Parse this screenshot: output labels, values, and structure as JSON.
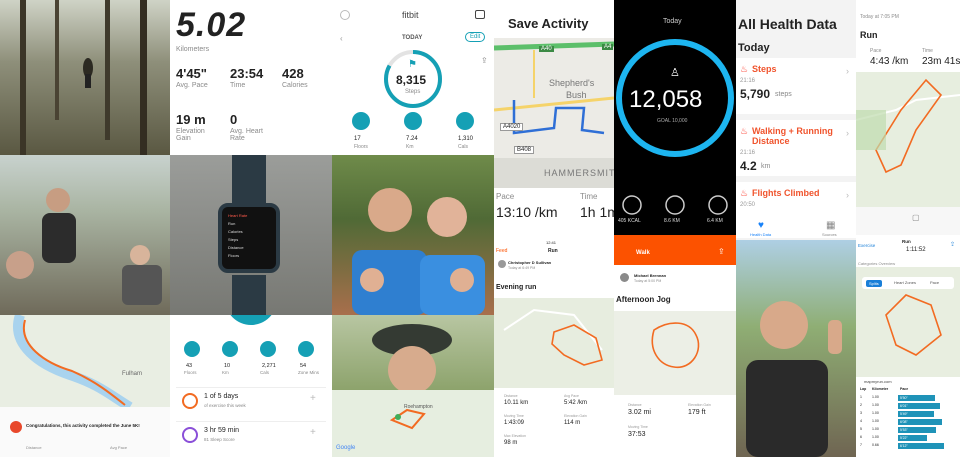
{
  "run_stats": {
    "distance": "5.02",
    "distance_unit": "Kilometers",
    "pace": "4'45\"",
    "pace_label": "Avg. Pace",
    "time": "23:54",
    "time_label": "Time",
    "calories": "428",
    "calories_label": "Calories",
    "elevation": "19 m",
    "elevation_label": "Elevation Gain",
    "heart": "0",
    "heart_label": "Avg. Heart Rate"
  },
  "fitbit": {
    "title": "fitbit",
    "today": "TODAY",
    "edit": "Edit",
    "steps": "8,315",
    "steps_label": "Steps",
    "stats": [
      {
        "value": "17",
        "label": "Floors",
        "icon": "stairs-icon"
      },
      {
        "value": "7.24",
        "label": "Km",
        "icon": "location-pin-icon"
      },
      {
        "value": "1,310",
        "label": "Cals",
        "icon": "flame-icon"
      }
    ]
  },
  "save_activity": {
    "title": "Save Activity",
    "map_labels": [
      "A40",
      "Shepherd's",
      "Bush",
      "A4020",
      "B408",
      "HAMMERSMITH",
      "A4"
    ],
    "pace_label": "Pace",
    "pace": "13:10 /km",
    "time_label": "Time",
    "time": "1h 1m"
  },
  "watch": {
    "today": "Today",
    "steps": "12,058",
    "goal": "GOAL 10,000",
    "metrics": [
      "405 KCAL",
      "8.6 KM",
      "6.4 KM"
    ]
  },
  "health": {
    "title": "All Health Data",
    "today": "Today",
    "items": [
      {
        "name": "Steps",
        "time": "21:16",
        "value": "5,790",
        "unit": "steps"
      },
      {
        "name": "Walking + Running Distance",
        "time": "21:16",
        "value": "4.2",
        "unit": "km"
      },
      {
        "name": "Flights Climbed",
        "time": "20:50",
        "value": "",
        "unit": ""
      }
    ],
    "tabs": [
      "Health Data",
      "Sources"
    ]
  },
  "strava_right": {
    "top_label": "Today at 7:05 PM",
    "title": "Run",
    "pace_label": "Pace",
    "pace": "4:43 /km",
    "time_label": "Time",
    "time": "23m 41s"
  },
  "watch_photo": {
    "screen_lines": [
      "Heart Rate",
      "Run",
      "Calories",
      "Steps",
      "Distance",
      "Floors"
    ]
  },
  "fitbit_bottom": {
    "stats": [
      {
        "value": "43",
        "label": "Floors"
      },
      {
        "value": "10",
        "label": "Km"
      },
      {
        "value": "2,271",
        "label": "Cals"
      },
      {
        "value": "54",
        "label": "Zone Mins"
      }
    ],
    "rows": [
      {
        "title": "1 of 5 days",
        "sub": "of exercise this week"
      },
      {
        "title": "3 hr 59 min",
        "sub": "81 Sleep Score"
      }
    ]
  },
  "evening_run": {
    "status": "12:41",
    "back": "Feed",
    "tab": "Run",
    "user": "Christopher D Sullivan",
    "user_sub": "Today at 6:49 PM",
    "title": "Evening run",
    "stats": [
      {
        "label": "Distance",
        "value": "10.11 km"
      },
      {
        "label": "Avg Pace",
        "value": "5:42 /km"
      },
      {
        "label": "Moving Time",
        "value": "1:43:09"
      },
      {
        "label": "Elevation Gain",
        "value": "114 m"
      },
      {
        "label": "Max Elevation",
        "value": "98 m"
      }
    ]
  },
  "afternoon_jog": {
    "header": "Walk",
    "user": "Michael Brennan",
    "user_sub": "Today at 5:00 PM",
    "title": "Afternoon Jog",
    "stats": [
      {
        "label": "Distance",
        "value": "3.02 mi"
      },
      {
        "label": "Elevation Gain",
        "value": "179 ft"
      },
      {
        "label": "Moving Time",
        "value": "37:53"
      }
    ]
  },
  "congrats": {
    "text": "Congratulations, this activity completed the June 5K!",
    "labels": [
      "Distance",
      "Avg Pace"
    ]
  },
  "map_labels": {
    "fulham": "Fulham",
    "google": "Google",
    "roehampton": "Roehampton"
  },
  "splits": {
    "back": "Exercise",
    "title": "Run",
    "time": "1:11:52",
    "tab_label": "Categories Overview",
    "tabs": [
      "Splits",
      "Heart Zones",
      "Pace"
    ],
    "url": "mapmyrun.com",
    "headers": [
      "Lap",
      "Kilometer",
      "Pace"
    ],
    "rows": [
      {
        "lap": "1",
        "km": "1.00",
        "pace": "5'50\"",
        "fill": 0.72
      },
      {
        "lap": "2",
        "km": "1.00",
        "pace": "6'01\"",
        "fill": 0.8
      },
      {
        "lap": "3",
        "km": "1.00",
        "pace": "5'49\"",
        "fill": 0.7
      },
      {
        "lap": "4",
        "km": "1.00",
        "pace": "6'08\"",
        "fill": 0.85
      },
      {
        "lap": "5",
        "km": "1.00",
        "pace": "5'53\"",
        "fill": 0.74
      },
      {
        "lap": "6",
        "km": "1.00",
        "pace": "5'22\"",
        "fill": 0.55
      },
      {
        "lap": "7",
        "km": "0.66",
        "pace": "6'12\"",
        "fill": 0.88
      }
    ]
  },
  "colors": {
    "fitbit_teal": "#15a0b5",
    "strava_orange": "#fc5200",
    "health_red": "#fb3c2d",
    "watch_blue": "#1db5f0"
  }
}
